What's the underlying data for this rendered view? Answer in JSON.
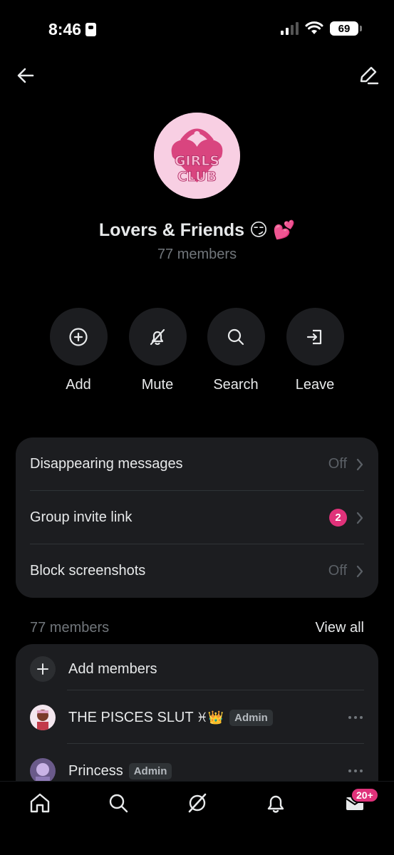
{
  "status_bar": {
    "time": "8:46",
    "battery": "69"
  },
  "header": {
    "back_icon": "arrow-left-icon",
    "edit_icon": "pencil-icon"
  },
  "group": {
    "avatar_text": "GIRLS CLUB",
    "name": "Lovers & Friends 😏 💕",
    "member_count": "77 members"
  },
  "actions": [
    {
      "label": "Add",
      "icon": "plus-circle-icon"
    },
    {
      "label": "Mute",
      "icon": "bell-off-icon"
    },
    {
      "label": "Search",
      "icon": "search-icon"
    },
    {
      "label": "Leave",
      "icon": "leave-icon"
    }
  ],
  "settings": [
    {
      "label": "Disappearing messages",
      "value": "Off"
    },
    {
      "label": "Group invite link",
      "badge": "2"
    },
    {
      "label": "Block screenshots",
      "value": "Off"
    }
  ],
  "members": {
    "count_label": "77 members",
    "view_all": "View all",
    "add_label": "Add members",
    "list": [
      {
        "name": "THE PISCES SLUT",
        "emoji": "♓👑",
        "tag": "Admin"
      },
      {
        "name": "Princess",
        "tag": "Admin"
      }
    ]
  },
  "bottom_nav": {
    "items": [
      "home-icon",
      "search-icon",
      "grok-icon",
      "bell-icon",
      "mail-icon"
    ],
    "dm_badge": "20+"
  },
  "colors": {
    "background": "#000000",
    "card": "#1c1d20",
    "accent_pink": "#e0327a",
    "avatar_pink": "#f8cfe3"
  }
}
